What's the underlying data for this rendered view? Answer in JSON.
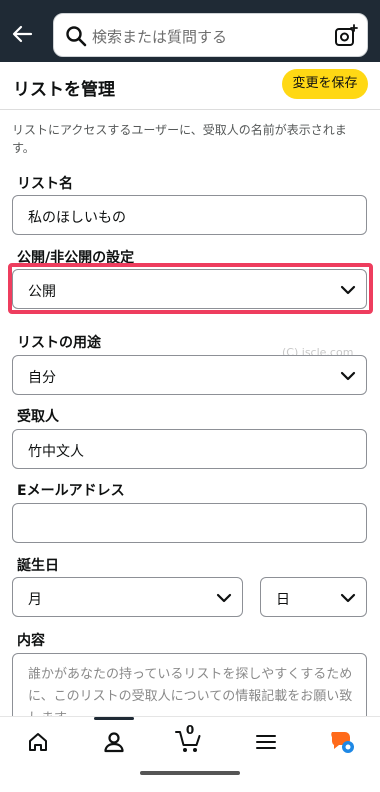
{
  "search": {
    "placeholder": "検索または質問する"
  },
  "header": {
    "title": "リストを管理",
    "save_label": "変更を保存"
  },
  "description": "リストにアクセスするユーザーに、受取人の名前が表示されます。",
  "form": {
    "list_name": {
      "label": "リスト名",
      "value": "私のほしいもの"
    },
    "privacy": {
      "label": "公開/非公開の設定",
      "value": "公開"
    },
    "purpose": {
      "label": "リストの用途",
      "value": "自分"
    },
    "recipient": {
      "label": "受取人",
      "value": "竹中文人"
    },
    "email": {
      "label": "Eメールアドレス",
      "value": ""
    },
    "birthday": {
      "label": "誕生日",
      "month": "月",
      "day": "日"
    },
    "content": {
      "label": "内容",
      "placeholder": "誰かがあなたの持っているリストを探しやすくするために、このリストの受取人についての情報記載をお願い致します。"
    }
  },
  "watermark": "(C) iscle.com",
  "bottom_nav": {
    "cart_count": "0"
  },
  "colors": {
    "accent_button": "#ffd814",
    "highlight": "#ee3d5e",
    "topbar": "#1f2a35",
    "ai_icon": "#ff6a1a"
  }
}
